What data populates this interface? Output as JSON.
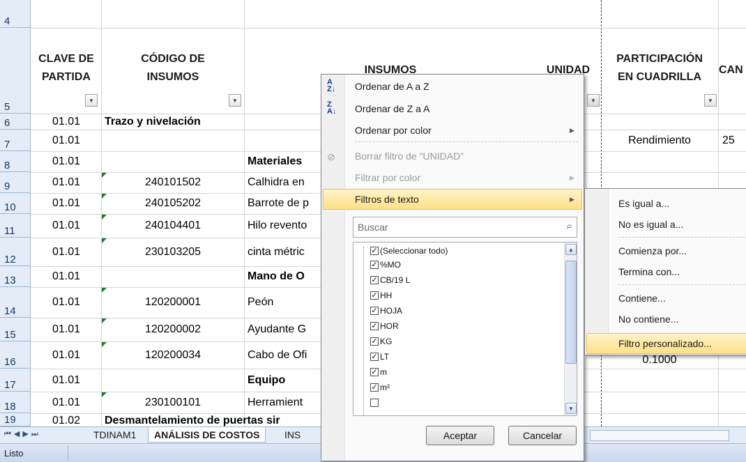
{
  "rows": [
    {
      "num": "4"
    },
    {
      "num": "5"
    },
    {
      "num": "6",
      "clave": "01.01",
      "codigo": "",
      "insumo": "Trazo y nivelación",
      "bold": true
    },
    {
      "num": "7",
      "clave": "01.01",
      "codigo": "",
      "insumo": "",
      "part": "Rendimiento",
      "cant": "25"
    },
    {
      "num": "8",
      "clave": "01.01",
      "codigo": "",
      "insumo": "Materiales",
      "bold": true
    },
    {
      "num": "9",
      "clave": "01.01",
      "codigo": "240101502",
      "insumo": "Calhidra en"
    },
    {
      "num": "10",
      "clave": "01.01",
      "codigo": "240105202",
      "insumo": "Barrote de p"
    },
    {
      "num": "11",
      "clave": "01.01",
      "codigo": "240104401",
      "insumo": "Hilo revento"
    },
    {
      "num": "12",
      "clave": "01.01",
      "codigo": "230103205",
      "insumo": "cinta métric"
    },
    {
      "num": "13",
      "clave": "01.01",
      "codigo": "",
      "insumo": "Mano de O",
      "bold": true
    },
    {
      "num": "14",
      "clave": "01.01",
      "codigo": "120200001",
      "insumo": "Peón"
    },
    {
      "num": "15",
      "clave": "01.01",
      "codigo": "120200002",
      "insumo": "Ayudante G"
    },
    {
      "num": "16",
      "clave": "01.01",
      "codigo": "120200034",
      "insumo": "Cabo de Ofi",
      "part": "0.1000"
    },
    {
      "num": "17",
      "clave": "01.01",
      "codigo": "",
      "insumo": "Equipo",
      "bold": true
    },
    {
      "num": "18",
      "clave": "01.01",
      "codigo": "230100101",
      "insumo": "Herramient"
    },
    {
      "num": "19",
      "clave": "01.02",
      "codigo": "",
      "insumo": "Desmantelamiento de puertas sir",
      "bold": true
    }
  ],
  "headers": {
    "clave": [
      "CLAVE DE",
      "PARTIDA"
    ],
    "codigo": [
      "CÓDIGO DE",
      "INSUMOS"
    ],
    "insumos": "INSUMOS",
    "unidad": "UNIDAD",
    "participacion": [
      "PARTICIPACIÓN",
      "EN CUADRILLA"
    ],
    "cantidad": "CAN"
  },
  "menu": {
    "sort_az": "Ordenar de A a Z",
    "sort_za": "Ordenar de Z a A",
    "sort_color": "Ordenar por color",
    "clear_filter": "Borrar filtro de \"UNIDAD\"",
    "filter_color": "Filtrar por color",
    "text_filters": "Filtros de texto",
    "search_placeholder": "Buscar",
    "list": [
      "(Seleccionar todo)",
      "%MO",
      "CB/19 L",
      "HH",
      "HOJA",
      "HOR",
      "KG",
      "LT",
      "m",
      "m²"
    ],
    "accept": "Aceptar",
    "cancel": "Cancelar"
  },
  "submenu": {
    "items": [
      "Es igual a...",
      "No es igual a...",
      "Comienza por...",
      "Termina con...",
      "Contiene...",
      "No contiene...",
      "Filtro personalizado..."
    ]
  },
  "tabs": {
    "t1": "TDINAM1",
    "t2": "ANÁLISIS DE COSTOS",
    "t3": "INS"
  },
  "status": "Listo",
  "icons": {
    "sort_az": "sort-ascending-icon",
    "sort_za": "sort-descending-icon",
    "clear": "clear-filter-icon",
    "search": "search-icon"
  }
}
